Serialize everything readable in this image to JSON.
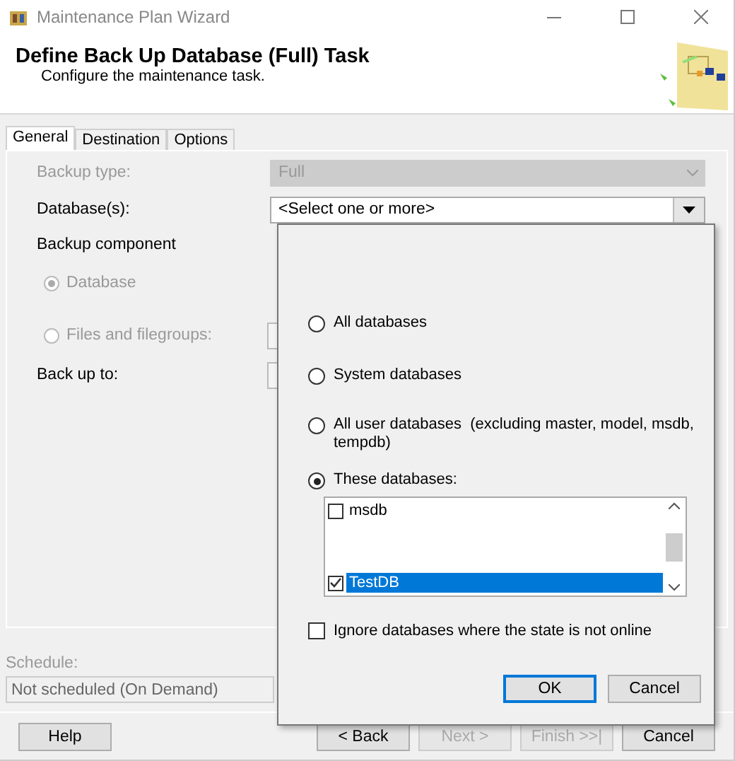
{
  "window": {
    "title": "Maintenance Plan Wizard"
  },
  "header": {
    "title": "Define Back Up Database (Full) Task",
    "subtitle": "Configure the maintenance task."
  },
  "tabs": [
    {
      "label": "General",
      "selected": true
    },
    {
      "label": "Destination",
      "selected": false
    },
    {
      "label": "Options",
      "selected": false
    }
  ],
  "form": {
    "backup_type": {
      "label": "Backup type:",
      "value": "Full",
      "disabled": true
    },
    "databases": {
      "label": "Database(s):",
      "value": "<Select one or more>"
    },
    "backup_component": {
      "label": "Backup component"
    },
    "component_options": [
      {
        "label": "Database",
        "selected": true,
        "disabled": true
      },
      {
        "label": "Files and filegroups:",
        "selected": false,
        "disabled": true
      }
    ],
    "back_up_to": {
      "label": "Back up to:"
    }
  },
  "popup": {
    "options": [
      {
        "label": "All databases",
        "selected": false
      },
      {
        "label": "System databases",
        "selected": false
      },
      {
        "label": "All user databases  (excluding master, model, msdb, tempdb)",
        "selected": false
      },
      {
        "label": "These databases:",
        "selected": true
      }
    ],
    "database_list": [
      {
        "name": "msdb",
        "checked": false,
        "selected": false
      },
      {
        "name": "TestDB",
        "checked": true,
        "selected": true
      }
    ],
    "ignore_offline": {
      "label": "Ignore databases where the state is not online",
      "checked": false
    },
    "buttons": [
      {
        "label": "OK",
        "default": true
      },
      {
        "label": "Cancel",
        "default": false
      }
    ]
  },
  "schedule": {
    "label": "Schedule:",
    "value": "Not scheduled (On Demand)"
  },
  "footer_buttons": [
    {
      "label": "Help",
      "disabled": false
    },
    {
      "label": "< Back",
      "disabled": false
    },
    {
      "label": "Next >",
      "disabled": true
    },
    {
      "label": "Finish >>|",
      "disabled": true
    },
    {
      "label": "Cancel",
      "disabled": false
    }
  ]
}
